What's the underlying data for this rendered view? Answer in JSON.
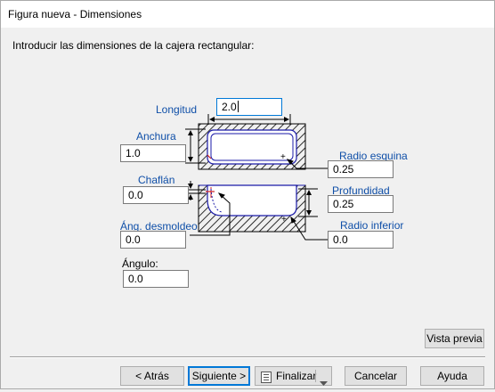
{
  "window": {
    "title": "Figura nueva - Dimensiones"
  },
  "instruction": "Introducir las dimensiones de la cajera rectangular:",
  "fields": {
    "longitud": {
      "label": "Longitud",
      "value": "2.0"
    },
    "anchura": {
      "label": "Anchura",
      "value": "1.0"
    },
    "chaflan": {
      "label": "Chaflán",
      "value": "0.0"
    },
    "ang_desmoldeo": {
      "label": "Áng. desmoldeo",
      "value": "0.0"
    },
    "angulo": {
      "label": "Ángulo:",
      "value": "0.0"
    },
    "radio_esquina": {
      "label": "Radio esquina",
      "value": "0.25"
    },
    "profundidad": {
      "label": "Profundidad",
      "value": "0.25"
    },
    "radio_inferior": {
      "label": "Radio inferior",
      "value": "0.0"
    }
  },
  "buttons": {
    "preview": "Vista previa",
    "back": "< Atrás",
    "next": "Siguiente >",
    "finish": "Finalizar",
    "cancel": "Cancelar",
    "help": "Ayuda"
  },
  "colors": {
    "label_blue": "#0f4fa8",
    "focus_border": "#0078d7",
    "outline_blue": "#1a1aa8",
    "marker_red": "#d02020"
  },
  "icons": {
    "finish": "document-list-icon",
    "dropdown": "chevron-down-icon"
  }
}
